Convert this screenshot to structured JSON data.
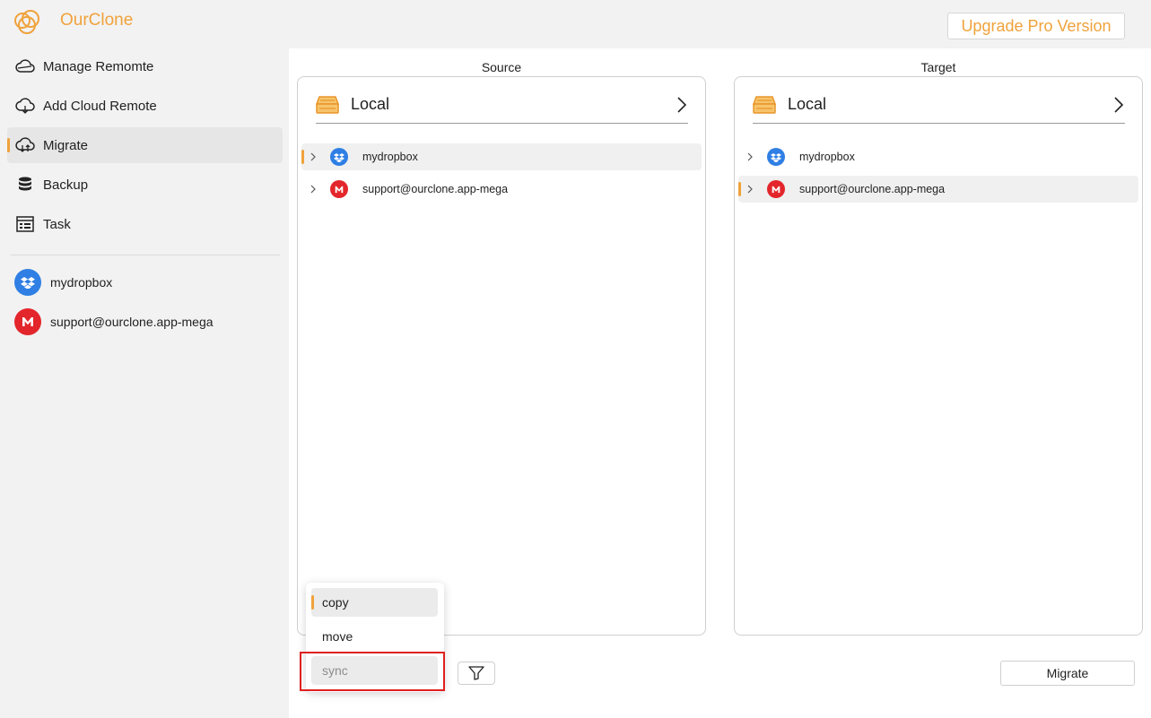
{
  "app": {
    "title": "OurClone",
    "upgrade_label": "Upgrade Pro Version",
    "accent_color": "#f0a23b"
  },
  "sidebar": {
    "nav": [
      {
        "label": "Manage Remomte",
        "icon": "cloud-outline-icon",
        "active": false
      },
      {
        "label": "Add Cloud Remote",
        "icon": "cloud-add-icon",
        "active": false
      },
      {
        "label": "Migrate",
        "icon": "cloud-migrate-icon",
        "active": true
      },
      {
        "label": "Backup",
        "icon": "database-icon",
        "active": false
      },
      {
        "label": "Task",
        "icon": "task-list-icon",
        "active": false
      }
    ],
    "remotes": [
      {
        "label": "mydropbox",
        "icon": "dropbox-icon",
        "color": "#2f7fe4"
      },
      {
        "label": "support@ourclone.app-mega",
        "icon": "mega-icon",
        "color": "#e3262b"
      }
    ]
  },
  "source": {
    "heading": "Source",
    "location": "Local",
    "items": [
      {
        "label": "mydropbox",
        "icon": "dropbox-icon",
        "selected": true
      },
      {
        "label": "support@ourclone.app-mega",
        "icon": "mega-icon",
        "selected": false
      }
    ]
  },
  "target": {
    "heading": "Target",
    "location": "Local",
    "items": [
      {
        "label": "mydropbox",
        "icon": "dropbox-icon",
        "selected": false
      },
      {
        "label": "support@ourclone.app-mega",
        "icon": "mega-icon",
        "selected": true
      }
    ]
  },
  "mode_menu": {
    "options": [
      {
        "label": "copy",
        "state": "selected"
      },
      {
        "label": "move",
        "state": "normal"
      },
      {
        "label": "sync",
        "state": "disabled"
      }
    ]
  },
  "actions": {
    "filter_icon": "filter-icon",
    "migrate_label": "Migrate"
  }
}
